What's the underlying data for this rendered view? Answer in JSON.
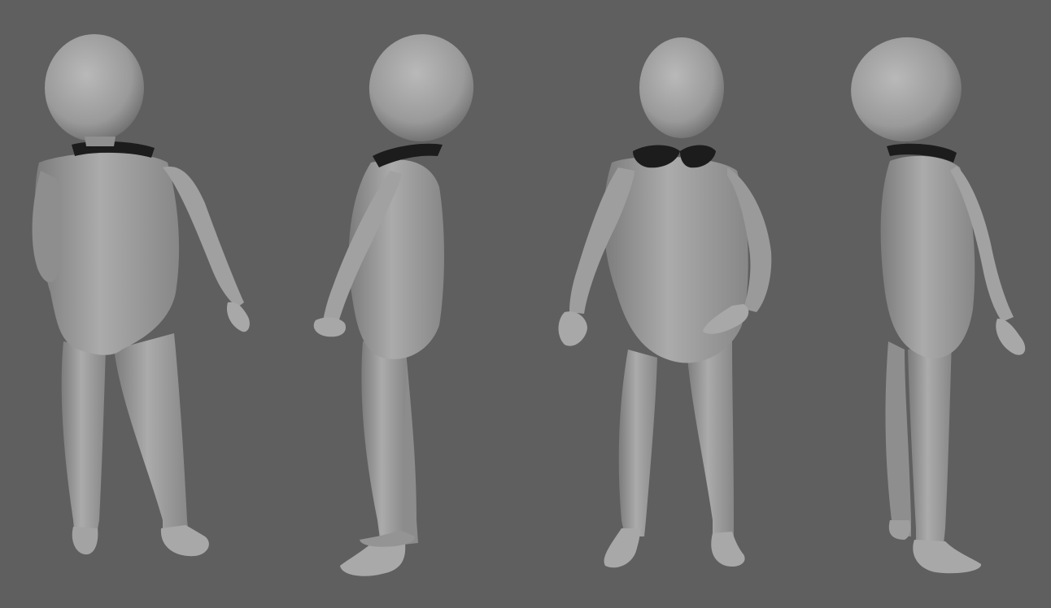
{
  "scene": {
    "background_color": "#5f5f5f",
    "body_color": "#9c9c9c",
    "body_light_color": "#b4b4b4",
    "body_shadow_color": "#6e6e6e",
    "collar_color": "#1c1c1c",
    "views": [
      {
        "view": "back-left"
      },
      {
        "view": "side-left"
      },
      {
        "view": "front"
      },
      {
        "view": "back-right"
      }
    ]
  }
}
